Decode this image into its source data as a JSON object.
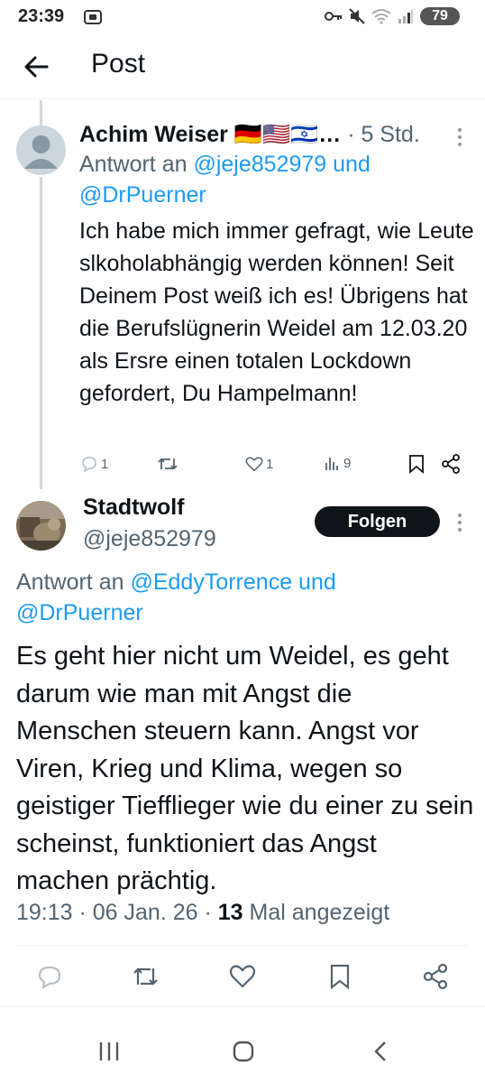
{
  "status_bar": {
    "time": "23:39",
    "battery": "79",
    "icons": [
      "screenshot-icon",
      "key-icon",
      "mute-icon",
      "wifi-icon",
      "signal-icon",
      "battery-icon"
    ]
  },
  "header": {
    "title": "Post",
    "back_icon": "arrow-left-icon"
  },
  "reply": {
    "author_name": "Achim Weiser",
    "flags_text": "🇩🇪🇺🇸🇮🇱…",
    "time": "· 5 Std.",
    "reply_to_prefix": "Antwort an",
    "reply_to_handles": "@jeje852979 und @DrPuerner",
    "text": "Ich habe mich immer gefragt, wie Leute slkoholabhängig werden können! Seit Deinem Post weiß ich es! Übrigens hat die Berufslügnerin Weidel am 12.03.20 als Ersre einen totalen Lockdown gefordert, Du Hampelmann!",
    "actions": {
      "replies": "1",
      "likes": "1",
      "views": "9"
    }
  },
  "post": {
    "author_name": "Stadtwolf",
    "handle": "@jeje852979",
    "follow_label": "Folgen",
    "reply_to_prefix": "Antwort an",
    "reply_to_handles": "@EddyTorrence und @DrPuerner",
    "text": "Es geht hier nicht um Weidel, es geht darum wie man mit Angst die Menschen steuern kann.  Angst vor Viren, Krieg und Klima, wegen so geistiger Tiefflieger wie du einer zu sein scheinst, funktioniert das Angst machen prächtig.",
    "time": "19:13 · 06 Jan. 26 ·",
    "views_count": "13",
    "views_label": "Mal angezeigt"
  },
  "colors": {
    "text": "#0f1419",
    "secondary": "#536471",
    "link": "#1d9bf0",
    "follow_bg": "#0f1419",
    "thread_line": "#cfd9de"
  },
  "nav_bar": {
    "icons": [
      "recent-apps-icon",
      "home-icon",
      "back-icon"
    ]
  }
}
